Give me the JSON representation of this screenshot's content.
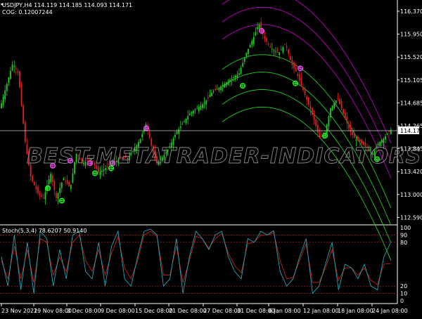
{
  "header": {
    "symbol_line": "USDJPY,H4  114.119 114.185 114.093 114.171",
    "indicator_line": "COG: 0.12007244"
  },
  "watermark": "BEST-METATRADER-INDICATORS.COM",
  "colors": {
    "background": "#000000",
    "bull_candle": "#22cc22",
    "bear_candle": "#dd2222",
    "upper_band": "#c000c0",
    "lower_band": "#22cc22",
    "sell_marker": "#ff44ff",
    "buy_marker": "#22ff22",
    "stoch_main": "#29a3b3",
    "stoch_signal": "#c02020",
    "current_price_line": "#cccccc"
  },
  "price_axis": {
    "labels": [
      "116.370",
      "115.950",
      "115.520",
      "115.105",
      "114.685",
      "114.265",
      "113.845",
      "113.420",
      "113.000",
      "112.590"
    ],
    "current_price": "114.171",
    "range": [
      112.35,
      116.6
    ]
  },
  "time_axis": {
    "labels": [
      "23 Nov 2021",
      "29 Nov 08:00",
      "3 Dec 08:00",
      "9 Dec 08:00",
      "15 Dec 08:00",
      "21 Dec 08:00",
      "27 Dec 08:00",
      "31 Dec 08:00",
      "6 Jan 08:00",
      "12 Jan 08:00",
      "18 Jan 08:00",
      "24 Jan 08:00"
    ]
  },
  "stoch": {
    "title": "Stoch(5,3,4) 78.6207 50.9140",
    "axis_labels": [
      "100",
      "90",
      "80",
      "20",
      "10",
      "0"
    ],
    "levels": [
      90,
      80,
      20,
      10
    ]
  },
  "chart_data": {
    "type": "candlestick",
    "symbol": "USDJPY",
    "timeframe": "H4",
    "ohlc_last": {
      "open": 114.119,
      "high": 114.185,
      "low": 114.093,
      "close": 114.171
    },
    "price_range": [
      112.35,
      116.6
    ],
    "close_path": [
      [
        0,
        114.6
      ],
      [
        8,
        115.0
      ],
      [
        18,
        115.5
      ],
      [
        26,
        115.3
      ],
      [
        36,
        113.9
      ],
      [
        44,
        113.2
      ],
      [
        54,
        112.9
      ],
      [
        62,
        112.8
      ],
      [
        72,
        113.3
      ],
      [
        80,
        112.8
      ],
      [
        90,
        113.2
      ],
      [
        100,
        113.0
      ],
      [
        108,
        113.7
      ],
      [
        118,
        113.5
      ],
      [
        130,
        113.6
      ],
      [
        140,
        113.3
      ],
      [
        150,
        113.4
      ],
      [
        160,
        113.5
      ],
      [
        172,
        113.6
      ],
      [
        182,
        113.6
      ],
      [
        192,
        113.8
      ],
      [
        200,
        114.0
      ],
      [
        208,
        114.3
      ],
      [
        216,
        113.8
      ],
      [
        222,
        113.5
      ],
      [
        230,
        113.6
      ],
      [
        240,
        113.8
      ],
      [
        250,
        114.1
      ],
      [
        260,
        114.3
      ],
      [
        270,
        114.5
      ],
      [
        280,
        114.6
      ],
      [
        290,
        114.7
      ],
      [
        300,
        114.9
      ],
      [
        310,
        115.0
      ],
      [
        320,
        115.1
      ],
      [
        330,
        115.2
      ],
      [
        340,
        115.3
      ],
      [
        350,
        115.7
      ],
      [
        360,
        116.0
      ],
      [
        368,
        116.3
      ],
      [
        376,
        116.0
      ],
      [
        386,
        115.8
      ],
      [
        396,
        115.7
      ],
      [
        406,
        115.9
      ],
      [
        414,
        115.5
      ],
      [
        422,
        115.3
      ],
      [
        430,
        115.0
      ],
      [
        438,
        114.7
      ],
      [
        446,
        114.4
      ],
      [
        454,
        114.0
      ],
      [
        462,
        114.1
      ],
      [
        470,
        114.6
      ],
      [
        480,
        114.8
      ],
      [
        488,
        114.5
      ],
      [
        496,
        114.2
      ],
      [
        504,
        114.0
      ],
      [
        514,
        113.9
      ],
      [
        522,
        113.8
      ],
      [
        530,
        113.7
      ],
      [
        538,
        113.9
      ],
      [
        546,
        114.0
      ],
      [
        555,
        114.17
      ]
    ],
    "sell_signals": [
      [
        75,
        113.45
      ],
      [
        100,
        113.55
      ],
      [
        128,
        113.5
      ],
      [
        160,
        113.5
      ],
      [
        208,
        114.2
      ],
      [
        372,
        116.15
      ],
      [
        427,
        115.4
      ]
    ],
    "buy_signals": [
      [
        68,
        113.0
      ],
      [
        88,
        112.75
      ],
      [
        135,
        113.3
      ],
      [
        158,
        113.4
      ],
      [
        345,
        115.05
      ],
      [
        420,
        115.1
      ],
      [
        462,
        114.05
      ],
      [
        536,
        113.58
      ]
    ],
    "stochastic": {
      "main": [
        60,
        20,
        90,
        15,
        80,
        10,
        95,
        85,
        20,
        70,
        30,
        90,
        95,
        40,
        30,
        80,
        20,
        75,
        95,
        30,
        20,
        60,
        95,
        98,
        90,
        20,
        30,
        85,
        10,
        60,
        95,
        85,
        70,
        90,
        95,
        60,
        40,
        30,
        85,
        80,
        95,
        90,
        96,
        40,
        20,
        30,
        60,
        85,
        10,
        20,
        50,
        80,
        15,
        50,
        45,
        30,
        50,
        20,
        15,
        60,
        78.62
      ],
      "signal": [
        55,
        30,
        75,
        30,
        70,
        25,
        85,
        80,
        35,
        60,
        40,
        80,
        90,
        55,
        40,
        70,
        35,
        65,
        88,
        45,
        30,
        55,
        90,
        95,
        88,
        35,
        35,
        75,
        25,
        55,
        88,
        85,
        72,
        85,
        92,
        65,
        48,
        38,
        78,
        80,
        90,
        90,
        93,
        55,
        30,
        32,
        55,
        78,
        25,
        25,
        45,
        70,
        28,
        45,
        45,
        35,
        45,
        28,
        22,
        50,
        50.91
      ]
    }
  }
}
